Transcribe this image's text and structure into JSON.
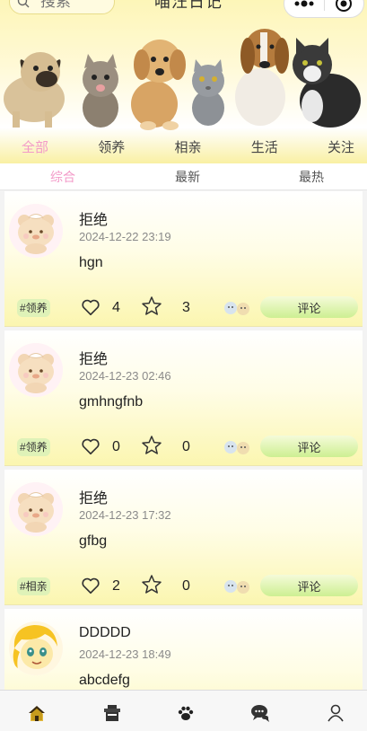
{
  "header": {
    "search_placeholder": "搜索",
    "title": "喵汪日记",
    "search_icon": "search-icon",
    "menu_icon": "more-dots-icon",
    "close_icon": "target-icon"
  },
  "banner": {
    "description_icon": "pets-banner"
  },
  "main_nav": {
    "items": [
      {
        "label": "全部",
        "active": true
      },
      {
        "label": "领养",
        "active": false
      },
      {
        "label": "相亲",
        "active": false
      },
      {
        "label": "生活",
        "active": false
      },
      {
        "label": "关注",
        "active": false
      }
    ]
  },
  "sort_tabs": {
    "items": [
      {
        "label": "综合",
        "active": true
      },
      {
        "label": "最新",
        "active": false
      },
      {
        "label": "最热",
        "active": false
      }
    ]
  },
  "feed": {
    "posts": [
      {
        "username": "拒绝",
        "time": "2024-12-22 23:19",
        "content": "hgn",
        "tag": "#领养",
        "likes": "4",
        "stars": "3",
        "comment_label": "评论",
        "avatar": "bear-avatar"
      },
      {
        "username": "拒绝",
        "time": "2024-12-23 02:46",
        "content": "gmhngfnb",
        "tag": "#领养",
        "likes": "0",
        "stars": "0",
        "comment_label": "评论",
        "avatar": "bear-avatar"
      },
      {
        "username": "拒绝",
        "time": "2024-12-23 17:32",
        "content": "gfbg",
        "tag": "#相亲",
        "likes": "2",
        "stars": "0",
        "comment_label": "评论",
        "avatar": "bear-avatar"
      },
      {
        "username": "DDDDD",
        "time": "2024-12-23 18:49",
        "content": "abcdefg",
        "avatar": "pony-avatar"
      }
    ]
  },
  "tabbar": {
    "items": [
      "home-icon",
      "shop-icon",
      "paw-icon",
      "chat-icon",
      "profile-icon"
    ]
  },
  "colors": {
    "accent_pink": "#f39ac8",
    "header_yellow": "#fdf6b8",
    "comment_green": "#cdef92"
  }
}
